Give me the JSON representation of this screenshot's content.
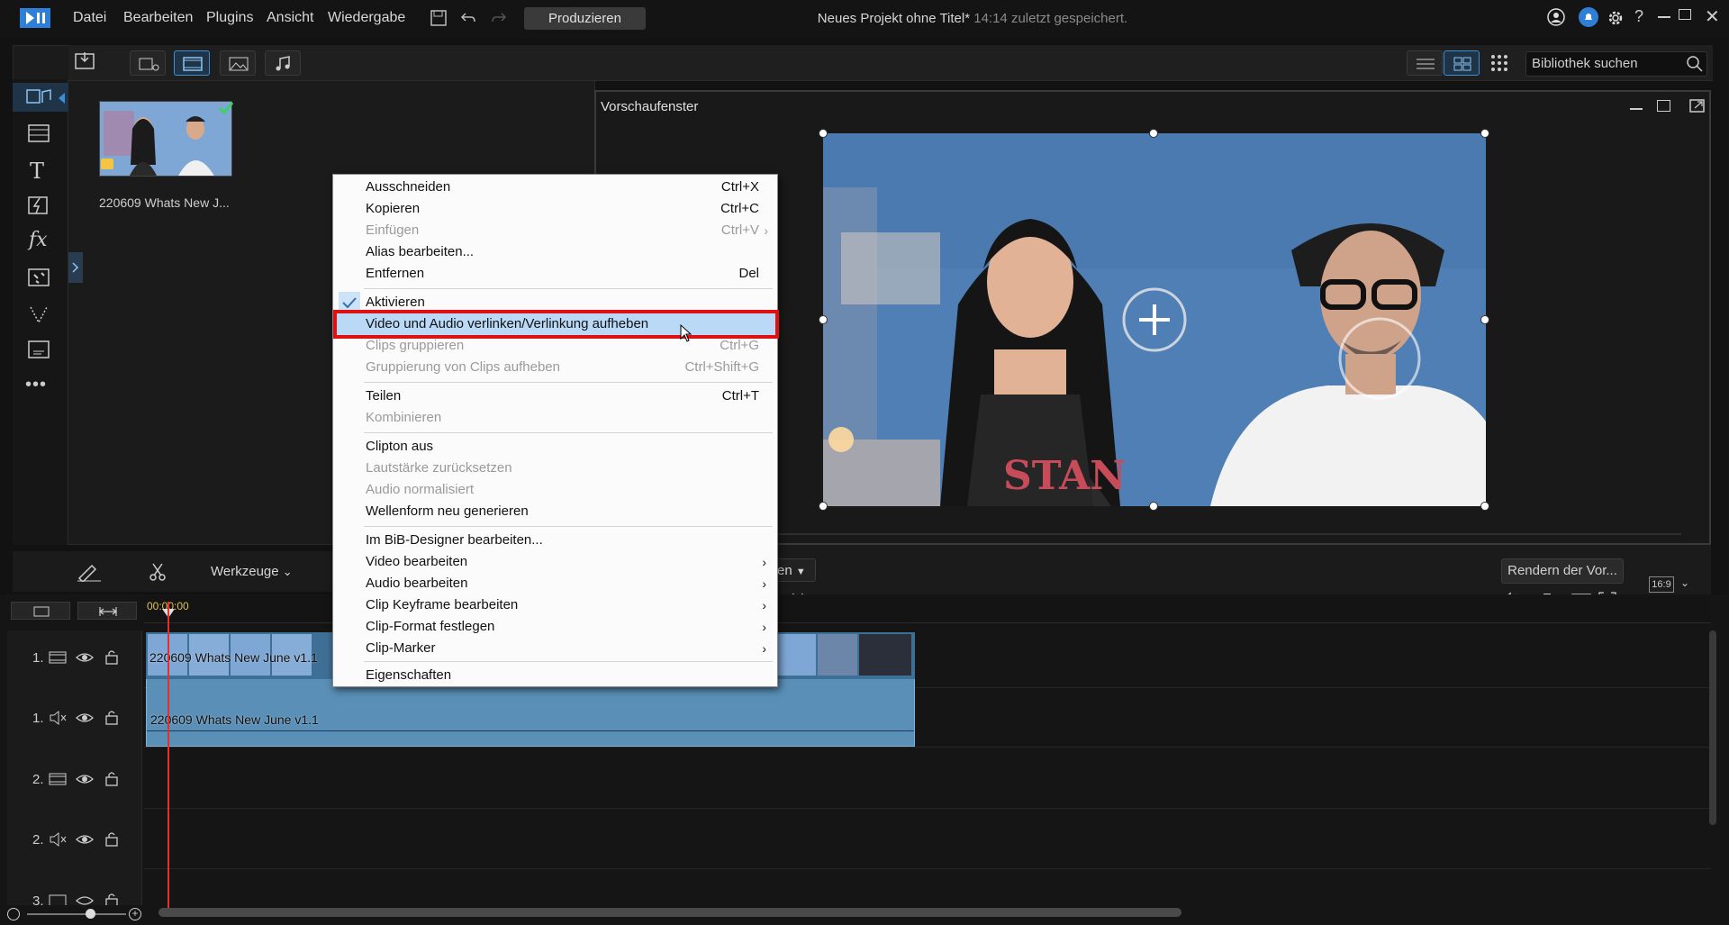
{
  "menubar": {
    "items": [
      "Datei",
      "Bearbeiten",
      "Plugins",
      "Ansicht",
      "Wiedergabe"
    ],
    "produce": "Produzieren",
    "project_title": "Neues Projekt ohne Titel*",
    "saved_status": "14:14 zuletzt gespeichert."
  },
  "library": {
    "search_placeholder": "Bibliothek suchen",
    "clip_label": "220609 Whats New J..."
  },
  "preview": {
    "title": "Vorschaufenster",
    "render_button": "Rendern der Vor...",
    "aspect": "16:9",
    "dropdown_partial": "en"
  },
  "timeline": {
    "tools_label": "Werkzeuge",
    "timecode": "00:00:00",
    "tracks": [
      {
        "num": "1.",
        "type": "video"
      },
      {
        "num": "1.",
        "type": "audio"
      },
      {
        "num": "2.",
        "type": "video"
      },
      {
        "num": "2.",
        "type": "audio"
      },
      {
        "num": "3.",
        "type": "video"
      }
    ],
    "video_clip_label": "220609 Whats New June v1.1",
    "audio_clip_label": "220609 Whats New June v1.1"
  },
  "context_menu": {
    "cut": {
      "label": "Ausschneiden",
      "shortcut": "Ctrl+X"
    },
    "copy": {
      "label": "Kopieren",
      "shortcut": "Ctrl+C"
    },
    "paste": {
      "label": "Einfügen",
      "shortcut": "Ctrl+V"
    },
    "alias": {
      "label": "Alias bearbeiten..."
    },
    "remove": {
      "label": "Entfernen",
      "shortcut": "Del"
    },
    "activate": {
      "label": "Aktivieren"
    },
    "link": {
      "label": "Video und Audio verlinken/Verlinkung aufheben"
    },
    "group": {
      "label": "Clips gruppieren",
      "shortcut": "Ctrl+G"
    },
    "ungroup": {
      "label": "Gruppierung von Clips aufheben",
      "shortcut": "Ctrl+Shift+G"
    },
    "split": {
      "label": "Teilen",
      "shortcut": "Ctrl+T"
    },
    "combine": {
      "label": "Kombinieren"
    },
    "mute": {
      "label": "Clipton aus"
    },
    "reset_volume": {
      "label": "Lautstärke zurücksetzen"
    },
    "normalize": {
      "label": "Audio normalisiert"
    },
    "waveform": {
      "label": "Wellenform neu generieren"
    },
    "pip": {
      "label": "Im BiB-Designer bearbeiten..."
    },
    "edit_video": {
      "label": "Video bearbeiten"
    },
    "edit_audio": {
      "label": "Audio bearbeiten"
    },
    "keyframe": {
      "label": "Clip Keyframe bearbeiten"
    },
    "format": {
      "label": "Clip-Format festlegen"
    },
    "marker": {
      "label": "Clip-Marker"
    },
    "properties": {
      "label": "Eigenschaften"
    }
  },
  "colors": {
    "highlight": "#b9d9f7",
    "annotation_box": "#e01010",
    "accent": "#3b8fd6"
  }
}
